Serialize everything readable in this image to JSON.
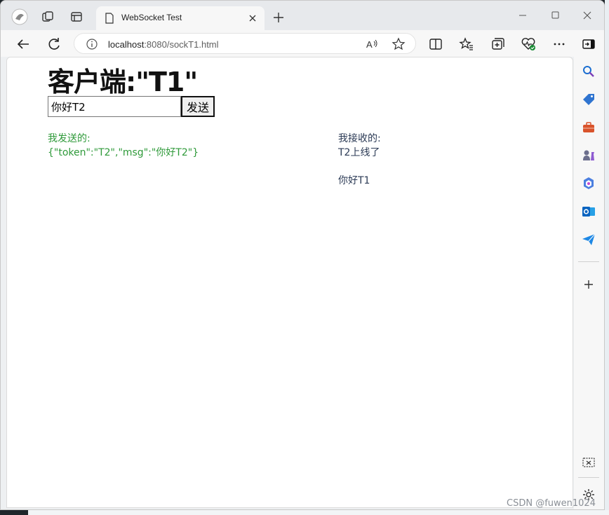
{
  "tab": {
    "title": "WebSocket Test"
  },
  "address": {
    "host": "localhost",
    "rest": ":8080/sockT1.html"
  },
  "page": {
    "heading_prefix": "客户端:",
    "heading_name": "\"T1\"",
    "input_value": "你好T2",
    "send_label": "发送",
    "sent_label": "我发送的:",
    "sent_messages": [
      "{\"token\":\"T2\",\"msg\":\"你好T2\"}"
    ],
    "received_label": "我接收的:",
    "received_messages": [
      "T2上线了",
      "你好T1"
    ]
  },
  "watermark": "CSDN @fuwen1024",
  "colors": {
    "sent_text": "#2f9a3a",
    "received_text": "#2b3a55",
    "accent": "#0f6cbd"
  }
}
